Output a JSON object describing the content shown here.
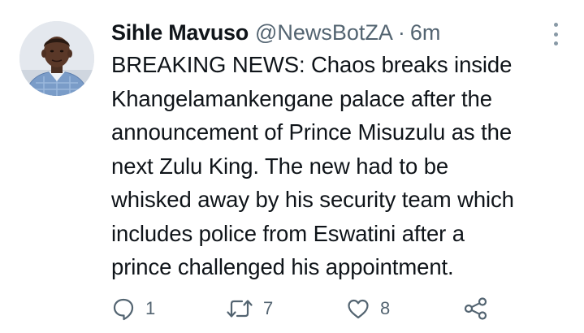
{
  "tweet": {
    "display_name": "Sihle Mavuso",
    "handle": "@NewsBotZA",
    "separator": "·",
    "time": "6m",
    "text_lines": [
      "BREAKING NEWS: Chaos breaks inside",
      "Khangelamankengane palace after the",
      "announcement of Prince Misuzulu as the",
      "next Zulu King. The new had to be",
      "whisked away by his security team which",
      "includes police from Eswatini after a",
      "prince challenged his appointment."
    ]
  },
  "actions": {
    "reply": {
      "icon": "reply-icon",
      "count": "1"
    },
    "retweet": {
      "icon": "retweet-icon",
      "count": "7"
    },
    "like": {
      "icon": "heart-icon",
      "count": "8"
    },
    "share": {
      "icon": "share-icon"
    }
  },
  "icons": {
    "more": "more-vertical-icon",
    "avatar": "avatar"
  },
  "colors": {
    "text": "#0f1419",
    "secondary": "#536471",
    "icon": "#536471",
    "more_dots": "#8899a6",
    "background": "#ffffff"
  }
}
